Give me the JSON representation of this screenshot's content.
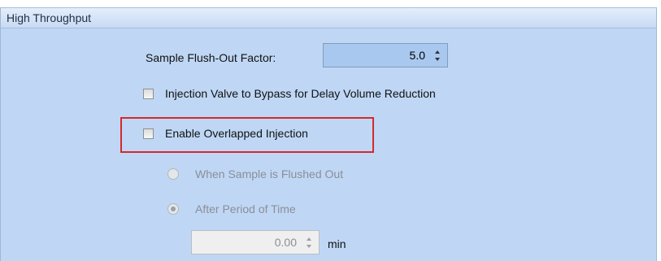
{
  "section": {
    "title": "High Throughput"
  },
  "flush_out_factor": {
    "label": "Sample Flush-Out Factor:",
    "value": "5.0"
  },
  "injection_valve_bypass": {
    "label": "Injection Valve to Bypass for Delay Volume Reduction",
    "checked": false
  },
  "overlapped_injection": {
    "label": "Enable Overlapped Injection",
    "checked": false,
    "highlight_color": "#d42a2a"
  },
  "overlap_mode": {
    "options": [
      {
        "label": "When Sample is Flushed Out",
        "selected": false,
        "enabled": false
      },
      {
        "label": "After Period of Time",
        "selected": true,
        "enabled": false
      }
    ]
  },
  "period": {
    "value": "0.00",
    "unit": "min",
    "enabled": false
  },
  "colors": {
    "panel_background": "#bfd7f5",
    "spinbox_active": "#a9c8ef",
    "disabled_text": "#8a8f96"
  }
}
